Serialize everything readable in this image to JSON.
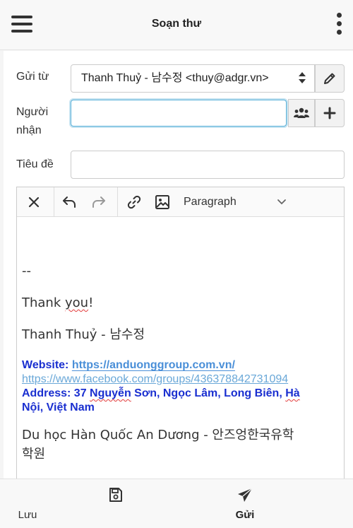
{
  "header": {
    "title": "Soạn thư"
  },
  "form": {
    "from_label": "Gửi từ",
    "from_value": "Thanh Thuỷ - 남수정 <thuy@adgr.vn>",
    "to_label_line1": "Người",
    "to_label_line2": "nhận",
    "to_value": "",
    "subject_label": "Tiêu đề",
    "subject_value": ""
  },
  "editor": {
    "block_format": "Paragraph",
    "content": {
      "separator": "--",
      "thanks_prefix": "Thank ",
      "thanks_word": "you",
      "thanks_suffix": "!",
      "name": "Thanh Thuỷ - 남수정",
      "website_label": "Website: ",
      "website_url": "https://anduonggroup.com.vn/",
      "facebook_url": "https://www.facebook.com/groups/436378842731094",
      "address_line1_prefix": "Address: 37 ",
      "address_line1_word1": "Nguyễn",
      "address_line1_mid": " Sơn, Ngọc Lâm, Long Biên, ",
      "address_line1_word2": "Hà",
      "address_line2": "Nội, Việt Nam",
      "company_line1": "Du học Hàn Quốc An Dương - 안즈엉한국유학",
      "company_line2": "학원"
    }
  },
  "footer": {
    "save_label": "Lưu",
    "send_label": "Gửi"
  },
  "colors": {
    "focus_border": "#5ab0d8",
    "signature_blue": "#1a2fd0",
    "link_blue": "#4a8fd8",
    "spellcheck_red": "#e23b3b"
  }
}
